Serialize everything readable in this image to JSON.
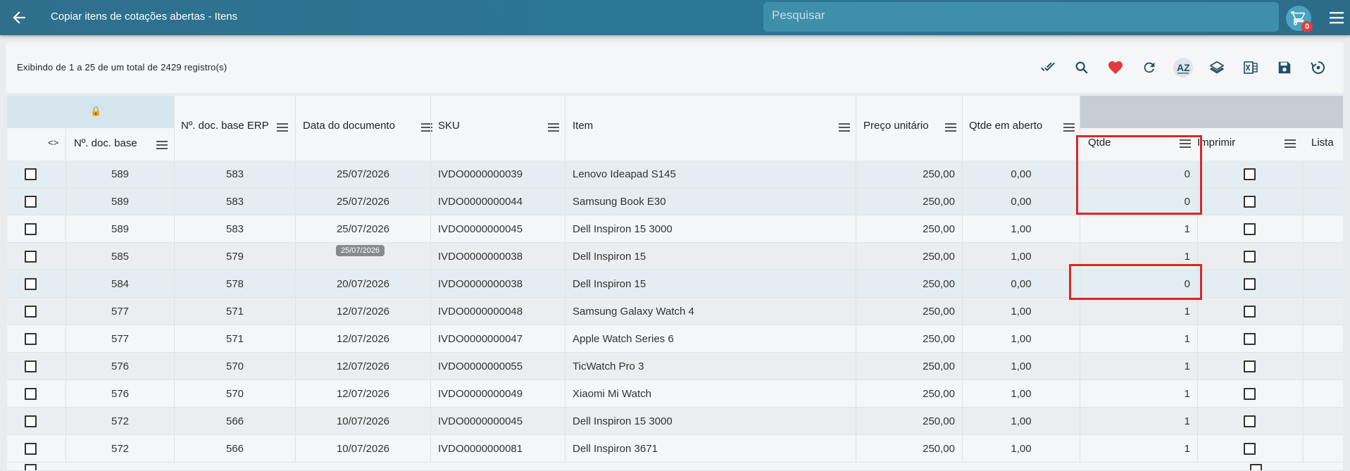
{
  "header": {
    "title": "Copiar itens de cotações abertas - Itens",
    "search_placeholder": "Pesquisar",
    "cart_count": "0"
  },
  "toolbar": {
    "record_info": "Exibindo de 1 a 25 de um total de 2429 registro(s)",
    "icons": [
      "check-all-icon",
      "search-icon",
      "heart-icon",
      "refresh-icon",
      "sort-az-icon",
      "layers-icon",
      "excel-icon",
      "save-icon",
      "restore-icon"
    ]
  },
  "columns": {
    "doc_base": "Nº. doc. base",
    "doc_base_erp": "Nº. doc. base ERP",
    "data_doc": "Data do documento",
    "sku": "SKU",
    "item": "Item",
    "preco": "Preço unitário",
    "qtde_aberto": "Qtde em aberto",
    "qtde": "Qtde",
    "imprimir": "Imprimir",
    "lista": "Lista"
  },
  "tooltip": "25/07/2026",
  "rows": [
    {
      "doc_base": "589",
      "doc_base_erp": "583",
      "data": "25/07/2026",
      "sku": "IVDO0000000039",
      "item": "Lenovo Ideapad S145",
      "preco": "250,00",
      "qtde_aberto": "0,00",
      "qtde": "0"
    },
    {
      "doc_base": "589",
      "doc_base_erp": "583",
      "data": "25/07/2026",
      "sku": "IVDO0000000044",
      "item": "Samsung Book E30",
      "preco": "250,00",
      "qtde_aberto": "0,00",
      "qtde": "0"
    },
    {
      "doc_base": "589",
      "doc_base_erp": "583",
      "data": "25/07/2026",
      "sku": "IVDO0000000045",
      "item": "Dell Inspiron 15 3000",
      "preco": "250,00",
      "qtde_aberto": "1,00",
      "qtde": "1"
    },
    {
      "doc_base": "585",
      "doc_base_erp": "579",
      "data": "",
      "sku": "IVDO0000000038",
      "item": "Dell Inspiron 15",
      "preco": "250,00",
      "qtde_aberto": "1,00",
      "qtde": "1"
    },
    {
      "doc_base": "584",
      "doc_base_erp": "578",
      "data": "20/07/2026",
      "sku": "IVDO0000000038",
      "item": "Dell Inspiron 15",
      "preco": "250,00",
      "qtde_aberto": "0,00",
      "qtde": "0"
    },
    {
      "doc_base": "577",
      "doc_base_erp": "571",
      "data": "12/07/2026",
      "sku": "IVDO0000000048",
      "item": "Samsung Galaxy Watch 4",
      "preco": "250,00",
      "qtde_aberto": "1,00",
      "qtde": "1"
    },
    {
      "doc_base": "577",
      "doc_base_erp": "571",
      "data": "12/07/2026",
      "sku": "IVDO0000000047",
      "item": "Apple Watch Series 6",
      "preco": "250,00",
      "qtde_aberto": "1,00",
      "qtde": "1"
    },
    {
      "doc_base": "576",
      "doc_base_erp": "570",
      "data": "12/07/2026",
      "sku": "IVDO0000000055",
      "item": "TicWatch Pro 3",
      "preco": "250,00",
      "qtde_aberto": "1,00",
      "qtde": "1"
    },
    {
      "doc_base": "576",
      "doc_base_erp": "570",
      "data": "12/07/2026",
      "sku": "IVDO0000000049",
      "item": "Xiaomi Mi Watch",
      "preco": "250,00",
      "qtde_aberto": "1,00",
      "qtde": "1"
    },
    {
      "doc_base": "572",
      "doc_base_erp": "566",
      "data": "10/07/2026",
      "sku": "IVDO0000000045",
      "item": "Dell Inspiron 15 3000",
      "preco": "250,00",
      "qtde_aberto": "1,00",
      "qtde": "1"
    },
    {
      "doc_base": "572",
      "doc_base_erp": "566",
      "data": "10/07/2026",
      "sku": "IVDO0000000081",
      "item": "Dell Inspiron 3671",
      "preco": "250,00",
      "qtde_aberto": "1,00",
      "qtde": "1"
    }
  ],
  "colors": {
    "topbar": "#2a7795",
    "row_highlight": "#e4eef2",
    "row_white": "#f4f6f8",
    "row_grey": "#ebedf0",
    "red_box": "#d42a2a",
    "heart": "#e23a3a"
  }
}
